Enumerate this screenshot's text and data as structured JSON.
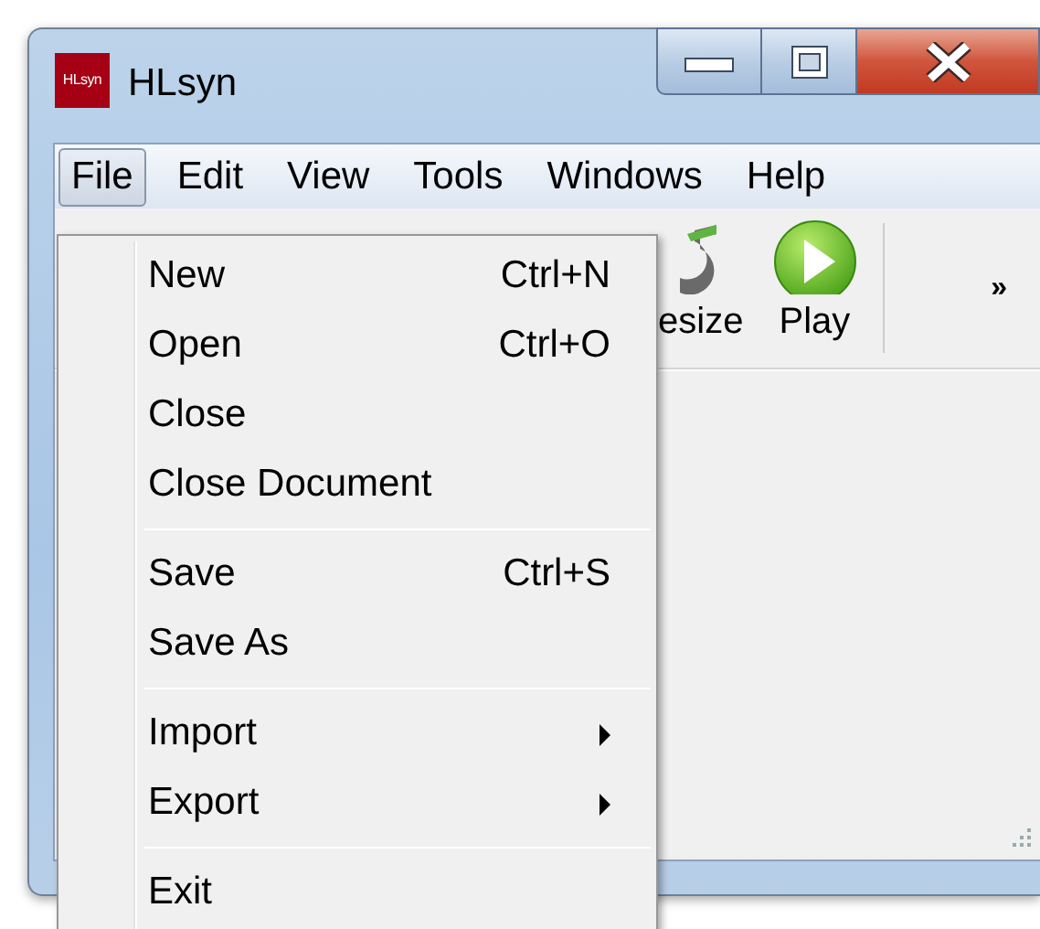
{
  "window": {
    "title": "HLsyn",
    "app_icon_text": "HLsyn"
  },
  "menu_bar": [
    {
      "label": "File",
      "selected": true
    },
    {
      "label": "Edit",
      "selected": false
    },
    {
      "label": "View",
      "selected": false
    },
    {
      "label": "Tools",
      "selected": false
    },
    {
      "label": "Windows",
      "selected": false
    },
    {
      "label": "Help",
      "selected": false
    }
  ],
  "toolbar": {
    "items": [
      {
        "label": "esize"
      },
      {
        "label": "Play"
      }
    ],
    "overflow": "»"
  },
  "file_menu": [
    {
      "kind": "item",
      "label": "New",
      "shortcut": "Ctrl+N"
    },
    {
      "kind": "item",
      "label": "Open",
      "shortcut": "Ctrl+O"
    },
    {
      "kind": "item",
      "label": "Close"
    },
    {
      "kind": "item",
      "label": "Close Document"
    },
    {
      "kind": "separator"
    },
    {
      "kind": "item",
      "label": "Save",
      "shortcut": "Ctrl+S"
    },
    {
      "kind": "item",
      "label": "Save As"
    },
    {
      "kind": "separator"
    },
    {
      "kind": "submenu",
      "label": "Import"
    },
    {
      "kind": "submenu",
      "label": "Export"
    },
    {
      "kind": "separator"
    },
    {
      "kind": "item",
      "label": "Exit"
    }
  ]
}
